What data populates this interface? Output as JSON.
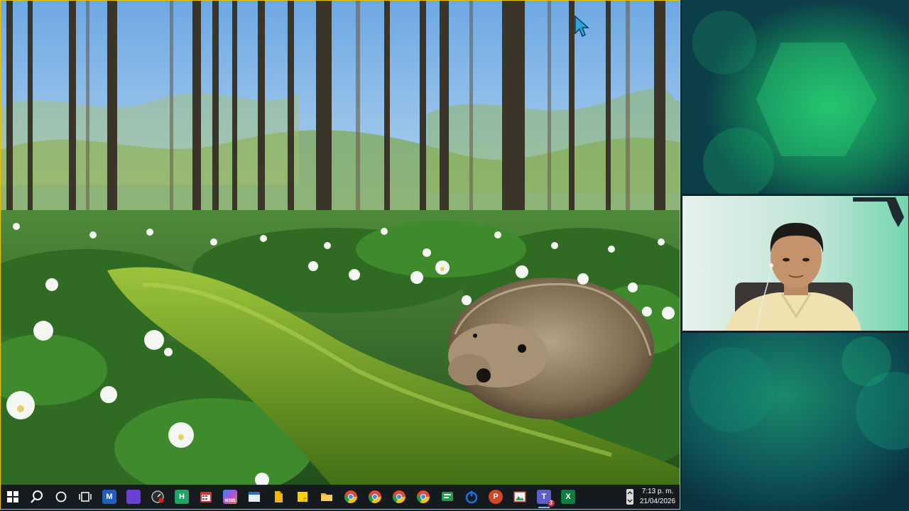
{
  "shared_screen": {
    "wallpaper": "hedgehog-on-moss-forest-photo",
    "border_color": "#e6c200"
  },
  "taskbar": {
    "items": [
      {
        "name": "start-button",
        "icon": "windows-logo-icon"
      },
      {
        "name": "search-button",
        "icon": "search-icon"
      },
      {
        "name": "cortana-button",
        "icon": "circle-icon"
      },
      {
        "name": "task-view-button",
        "icon": "task-view-icon"
      },
      {
        "name": "app-1",
        "glyph": "M",
        "color": "#1f5fbf"
      },
      {
        "name": "app-2",
        "glyph": "",
        "color": "#6b3fd1"
      },
      {
        "name": "app-3",
        "glyph": "",
        "color": "#3a3a3a"
      },
      {
        "name": "app-4",
        "glyph": "H",
        "color": "#21a366"
      },
      {
        "name": "app-5",
        "glyph": "",
        "color": "#d13438"
      },
      {
        "name": "app-m365",
        "glyph": "M365",
        "color": "#7b5cd6"
      },
      {
        "name": "app-7",
        "glyph": "",
        "color": "#e8eef6"
      },
      {
        "name": "app-8",
        "glyph": "",
        "color": "#f2b600"
      },
      {
        "name": "app-9",
        "glyph": "",
        "color": "#f7d200"
      },
      {
        "name": "file-explorer",
        "glyph": "",
        "color": "#e9b840"
      },
      {
        "name": "chrome-1",
        "glyph": "",
        "color": "#dd4b39"
      },
      {
        "name": "chrome-2",
        "glyph": "",
        "color": "#dd4b39"
      },
      {
        "name": "chrome-3",
        "glyph": "",
        "color": "#dd4b39"
      },
      {
        "name": "chrome-4",
        "glyph": "",
        "color": "#dd4b39"
      },
      {
        "name": "app-15",
        "glyph": "",
        "color": "#1e9e4a"
      },
      {
        "name": "app-16",
        "glyph": "",
        "color": "#1a73e8"
      },
      {
        "name": "powerpoint",
        "glyph": "P",
        "color": "#d24726"
      },
      {
        "name": "app-18",
        "glyph": "",
        "color": "#c0392b"
      },
      {
        "name": "teams",
        "glyph": "T",
        "color": "#5b5fc7",
        "badge": "3"
      },
      {
        "name": "excel",
        "glyph": "X",
        "color": "#107c41"
      }
    ],
    "clock_time": "7:13 p. m.",
    "clock_date": "21/04/2026"
  },
  "side_panel": {
    "participant_tile_bg": "#bfe4d6"
  }
}
